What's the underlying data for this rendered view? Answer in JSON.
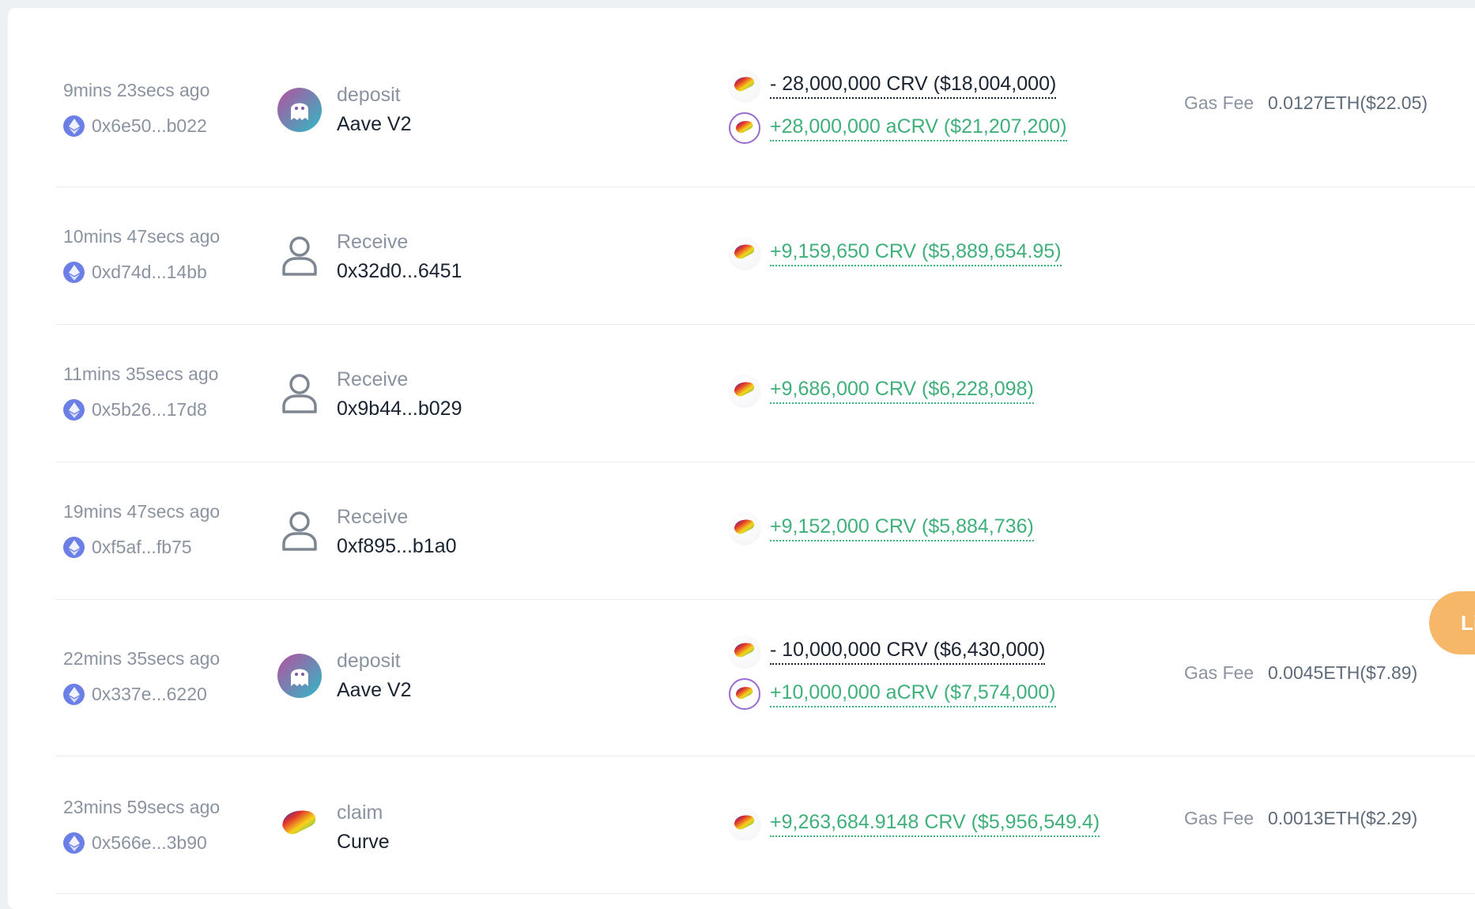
{
  "rows": [
    {
      "time": "9mins 23secs ago",
      "hash": "0x6e50...b022",
      "protocol_icon": "aave-icon",
      "action": "deposit",
      "target": "Aave V2",
      "tokens": [
        {
          "icon": "crv-icon",
          "amount": "- 28,000,000 CRV ($18,004,000)",
          "direction": "out"
        },
        {
          "icon": "acrv-icon",
          "amount": "+28,000,000 aCRV ($21,207,200)",
          "direction": "in"
        }
      ],
      "gas_label": "Gas Fee",
      "gas_value": "0.0127ETH($22.05)"
    },
    {
      "time": "10mins 47secs ago",
      "hash": "0xd74d...14bb",
      "protocol_icon": "user-icon",
      "action": "Receive",
      "target": "0x32d0...6451",
      "tokens": [
        {
          "icon": "crv-icon",
          "amount": "+9,159,650 CRV ($5,889,654.95)",
          "direction": "in"
        }
      ]
    },
    {
      "time": "11mins 35secs ago",
      "hash": "0x5b26...17d8",
      "protocol_icon": "user-icon",
      "action": "Receive",
      "target": "0x9b44...b029",
      "tokens": [
        {
          "icon": "crv-icon",
          "amount": "+9,686,000 CRV ($6,228,098)",
          "direction": "in"
        }
      ]
    },
    {
      "time": "19mins 47secs ago",
      "hash": "0xf5af...fb75",
      "protocol_icon": "user-icon",
      "action": "Receive",
      "target": "0xf895...b1a0",
      "tokens": [
        {
          "icon": "crv-icon",
          "amount": "+9,152,000 CRV ($5,884,736)",
          "direction": "in"
        }
      ]
    },
    {
      "time": "22mins 35secs ago",
      "hash": "0x337e...6220",
      "protocol_icon": "aave-icon",
      "action": "deposit",
      "target": "Aave V2",
      "tokens": [
        {
          "icon": "crv-icon",
          "amount": "- 10,000,000 CRV ($6,430,000)",
          "direction": "out"
        },
        {
          "icon": "acrv-icon",
          "amount": "+10,000,000 aCRV ($7,574,000)",
          "direction": "in"
        }
      ],
      "gas_label": "Gas Fee",
      "gas_value": "0.0045ETH($7.89)"
    },
    {
      "time": "23mins 59secs ago",
      "hash": "0x566e...3b90",
      "protocol_icon": "curve-icon",
      "action": "claim",
      "target": "Curve",
      "tokens": [
        {
          "icon": "crv-icon",
          "amount": "+9,263,684.9148 CRV ($5,956,549.4)",
          "direction": "in"
        }
      ],
      "gas_label": "Gas Fee",
      "gas_value": "0.0013ETH($2.29)"
    }
  ],
  "floating_button": {
    "label": "Li"
  },
  "colors": {
    "positive": "#3fb07a",
    "negative": "#1a2330",
    "muted": "#8a939f",
    "eth": "#6b7fe6",
    "floating": "#f6b768"
  }
}
